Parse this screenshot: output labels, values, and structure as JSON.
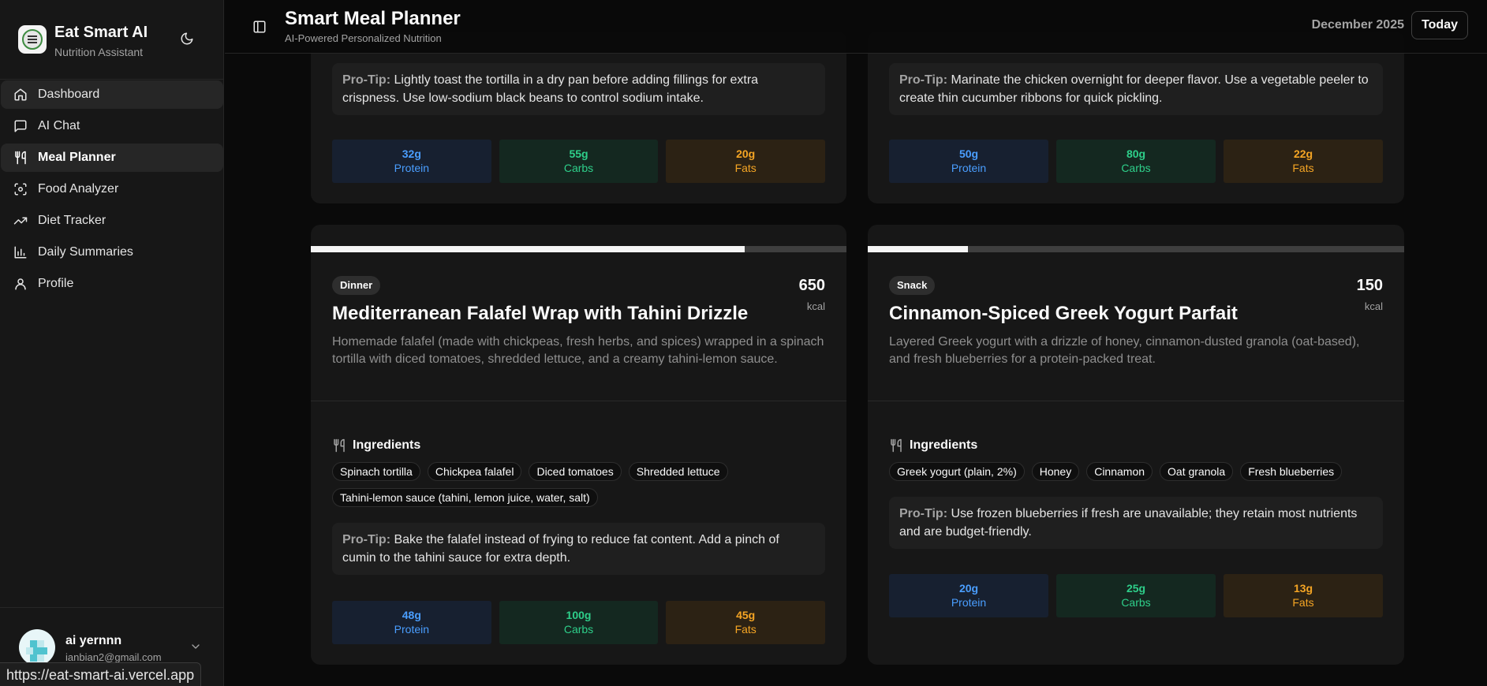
{
  "app": {
    "title": "Eat Smart AI",
    "subtitle": "Nutrition Assistant"
  },
  "nav": [
    {
      "label": "Dashboard",
      "icon": "home-icon"
    },
    {
      "label": "AI Chat",
      "icon": "chat-icon"
    },
    {
      "label": "Meal Planner",
      "icon": "utensils-icon"
    },
    {
      "label": "Food Analyzer",
      "icon": "scan-icon"
    },
    {
      "label": "Diet Tracker",
      "icon": "trending-up-icon"
    },
    {
      "label": "Daily Summaries",
      "icon": "bar-chart-icon"
    },
    {
      "label": "Profile",
      "icon": "user-icon"
    }
  ],
  "active_nav": "Meal Planner",
  "user": {
    "name": "ai yernnn",
    "email": "ianbian2@gmail.com"
  },
  "status_url": "https://eat-smart-ai.vercel.app",
  "header": {
    "title": "Smart Meal Planner",
    "subtitle": "AI-Powered Personalized Nutrition",
    "month": "December 2025",
    "today_label": "Today"
  },
  "top_cards": [
    {
      "tip_label": "Pro-Tip:",
      "tip": "Lightly toast the tortilla in a dry pan before adding fillings for extra crispness. Use low-sodium black beans to control sodium intake.",
      "protein": "32g",
      "carbs": "55g",
      "fats": "20g"
    },
    {
      "tip_label": "Pro-Tip:",
      "tip": "Marinate the chicken overnight for deeper flavor. Use a vegetable peeler to create thin cucumber ribbons for quick pickling.",
      "protein": "50g",
      "carbs": "80g",
      "fats": "22g"
    }
  ],
  "meals": [
    {
      "type": "Dinner",
      "calories": "650",
      "kcal_unit": "kcal",
      "progress": 0.81,
      "title": "Mediterranean Falafel Wrap with Tahini Drizzle",
      "description": "Homemade falafel (made with chickpeas, fresh herbs, and spices) wrapped in a spinach tortilla with diced tomatoes, shredded lettuce, and a creamy tahini-lemon sauce.",
      "ingredients_label": "Ingredients",
      "ingredients": [
        "Spinach tortilla",
        "Chickpea falafel",
        "Diced tomatoes",
        "Shredded lettuce",
        "Tahini-lemon sauce (tahini, lemon juice, water, salt)"
      ],
      "tip_label": "Pro-Tip:",
      "tip": "Bake the falafel instead of frying to reduce fat content. Add a pinch of cumin to the tahini sauce for extra depth.",
      "protein": "48g",
      "carbs": "100g",
      "fats": "45g"
    },
    {
      "type": "Snack",
      "calories": "150",
      "kcal_unit": "kcal",
      "progress": 0.187,
      "title": "Cinnamon-Spiced Greek Yogurt Parfait",
      "description": "Layered Greek yogurt with a drizzle of honey, cinnamon-dusted granola (oat-based), and fresh blueberries for a protein-packed treat.",
      "ingredients_label": "Ingredients",
      "ingredients": [
        "Greek yogurt (plain, 2%)",
        "Honey",
        "Cinnamon",
        "Oat granola",
        "Fresh blueberries"
      ],
      "tip_label": "Pro-Tip:",
      "tip": "Use frozen blueberries if fresh are unavailable; they retain most nutrients and are budget-friendly.",
      "protein": "20g",
      "carbs": "25g",
      "fats": "13g"
    }
  ],
  "macro_labels": {
    "protein": "Protein",
    "carbs": "Carbs",
    "fats": "Fats"
  },
  "colors": {
    "protein": "#4a9eff",
    "carbs": "#2ecf8a",
    "fats": "#f5a524",
    "background": "#0a0a0a",
    "card": "#171717"
  }
}
